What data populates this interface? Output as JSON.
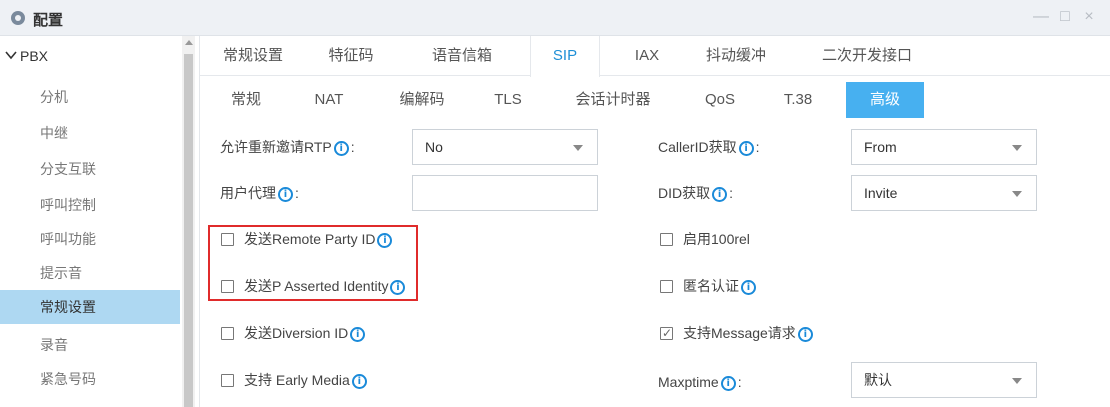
{
  "window": {
    "title": "配置",
    "minimize": "—",
    "maximize": "□",
    "close": "×"
  },
  "sidebar": {
    "root_label": "PBX",
    "items": [
      {
        "label": "分机"
      },
      {
        "label": "中继"
      },
      {
        "label": "分支互联"
      },
      {
        "label": "呼叫控制"
      },
      {
        "label": "呼叫功能"
      },
      {
        "label": "提示音"
      },
      {
        "label": "常规设置",
        "active": true
      },
      {
        "label": "录音"
      },
      {
        "label": "紧急号码"
      }
    ]
  },
  "tabs_primary": [
    "常规设置",
    "特征码",
    "语音信箱",
    "SIP",
    "IAX",
    "抖动缓冲",
    "二次开发接口"
  ],
  "tabs_primary_active": "SIP",
  "tabs_secondary": [
    "常规",
    "NAT",
    "编解码",
    "TLS",
    "会话计时器",
    "QoS",
    "T.38",
    "高级"
  ],
  "tabs_secondary_active": "高级",
  "form": {
    "reinvite_rtp": {
      "label": "允许重新邀请RTP",
      "value": "No"
    },
    "user_agent": {
      "label": "用户代理",
      "value": ""
    },
    "callerid_from": {
      "label": "CallerID获取",
      "value": "From"
    },
    "did_from": {
      "label": "DID获取",
      "value": "Invite"
    },
    "send_remote_party_id": {
      "label": "发送Remote Party ID",
      "checked": false
    },
    "send_p_asserted_identity": {
      "label": "发送P Asserted Identity",
      "checked": false
    },
    "send_diversion_id": {
      "label": "发送Diversion ID",
      "checked": false
    },
    "support_early_media": {
      "label": "支持 Early Media",
      "checked": false
    },
    "enable_100rel": {
      "label": "启用100rel",
      "checked": false
    },
    "anonymous_auth": {
      "label": "匿名认证",
      "checked": false
    },
    "support_message": {
      "label": "支持Message请求",
      "checked": true
    },
    "maxtime": {
      "label": "Maxptime",
      "value": "默认"
    }
  },
  "info_glyph": "i",
  "colon": ":",
  "colors": {
    "accent": "#1e8fd6",
    "active_tab": "#47b0f0",
    "active_side": "#aed8f2",
    "highlight": "#e02b2b"
  }
}
